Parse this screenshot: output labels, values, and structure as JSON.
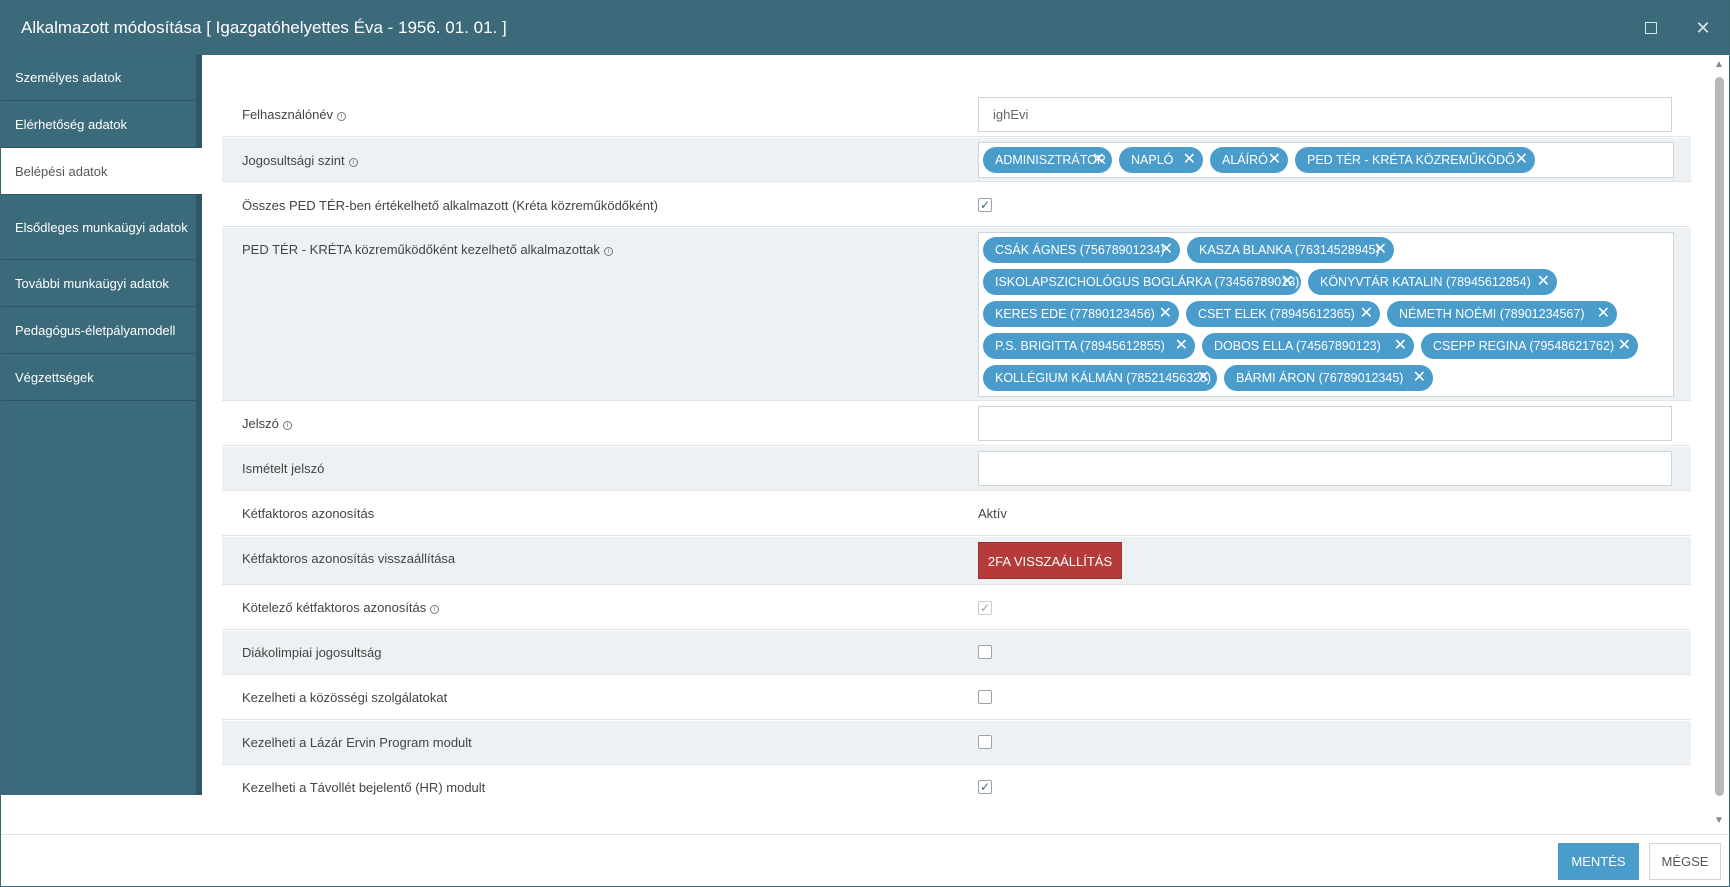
{
  "window": {
    "title": "Alkalmazott módosítása [ Igazgatóhelyettes Éva - 1956. 01. 01. ]",
    "maximize_icon": "maximize-icon",
    "close_icon": "close-icon",
    "close_glyph": "✕"
  },
  "sidebar": {
    "items": [
      {
        "label": "Személyes adatok",
        "active": false
      },
      {
        "label": "Elérhetőség adatok",
        "active": false
      },
      {
        "label": "Belépési adatok",
        "active": true
      },
      {
        "label": "Elsődleges munkaügyi adatok",
        "active": false
      },
      {
        "label": "További munkaügyi adatok",
        "active": false
      },
      {
        "label": "Pedagógus-életpályamodell",
        "active": false
      },
      {
        "label": "Végzettségek",
        "active": false
      }
    ]
  },
  "form": {
    "info_glyph": "i",
    "check_glyph": "✓",
    "tag_remove_glyph": "✕",
    "username": {
      "label": "Felhasználónév",
      "value": "ighEvi"
    },
    "permission_level": {
      "label": "Jogosultsági szint",
      "tags": [
        "ADMINISZTRÁTOR",
        "NAPLÓ",
        "ALÁÍRÓ",
        "PED TÉR - KRÉTA KÖZREMŰKÖDŐ"
      ]
    },
    "all_ped_ter": {
      "label": "Összes PED TÉR-ben értékelhető alkalmazott (Kréta közreműködőként)",
      "checked": true
    },
    "managed_employees": {
      "label": "PED TÉR - KRÉTA közreműködőként kezelhető alkalmazottak",
      "tags": [
        "CSÁK ÁGNES (75678901234)",
        "KASZA BLANKA (76314528945)",
        "ISKOLAPSZICHOLÓGUS BOGLÁRKA (73456789013)",
        "KÖNYVTÁR KATALIN (78945612854)",
        "KERES EDE (77890123456)",
        "CSET ELEK (78945612365)",
        "NÉMETH NOÉMI (78901234567)",
        "P.S. BRIGITTA (78945612855)",
        "DOBOS ELLA (74567890123)",
        "CSEPP REGINA (79548621762)",
        "KOLLÉGIUM KÁLMÁN (78521456325)",
        "BÁRMI ÁRON (76789012345)"
      ]
    },
    "password": {
      "label": "Jelszó",
      "value": ""
    },
    "password_repeat": {
      "label": "Ismételt jelszó",
      "value": ""
    },
    "two_factor": {
      "label": "Kétfaktoros azonosítás",
      "value": "Aktív"
    },
    "two_factor_reset": {
      "label": "Kétfaktoros azonosítás visszaállítása",
      "button": "2FA VISSZAÁLLÍTÁS"
    },
    "mandatory_two_factor": {
      "label": "Kötelező kétfaktoros azonosítás",
      "checked": true,
      "disabled": true
    },
    "student_olympics": {
      "label": "Diákolimpiai jogosultság",
      "checked": false
    },
    "community_service": {
      "label": "Kezelheti a közösségi szolgálatokat",
      "checked": false
    },
    "lazar_ervin": {
      "label": "Kezelheti a Lázár Ervin Program modult",
      "checked": false
    },
    "absence_hr": {
      "label": "Kezelheti a Távollét bejelentő (HR) modult",
      "checked": true
    }
  },
  "scrollbar": {
    "up_glyph": "▲",
    "down_glyph": "▼"
  },
  "footer": {
    "save": "MENTÉS",
    "cancel": "MÉGSE"
  },
  "colors": {
    "titlebar": "#3c6a7a",
    "sidebar": "#3b6a7a",
    "tag": "#4a9ccb",
    "danger": "#b53a3a",
    "primary": "#4a9ccb"
  }
}
